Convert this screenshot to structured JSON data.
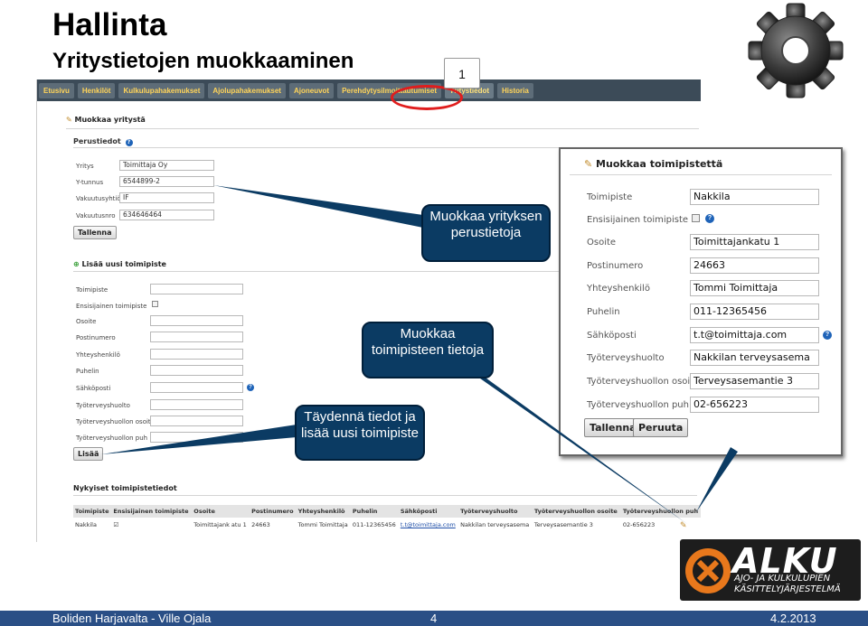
{
  "slide": {
    "title": "Hallinta",
    "subtitle": "Yritystietojen muokkaaminen",
    "marker_number": "1",
    "footer_left": "Boliden Harjavalta - Ville Ojala",
    "footer_center": "4",
    "footer_right": "4.2.2013"
  },
  "tabs": [
    "Etusivu",
    "Henkilöt",
    "Kulkulupahakemukset",
    "Ajolupahakemukset",
    "Ajoneuvot",
    "Perehdytysilmoittautumiset",
    "Yritystiedot",
    "Historia"
  ],
  "company_form": {
    "heading": "Muokkaa yritystä",
    "section": "Perustiedot",
    "fields": [
      {
        "label": "Yritys",
        "value": "Toimittaja Oy"
      },
      {
        "label": "Y-tunnus",
        "value": "6544899-2"
      },
      {
        "label": "Vakuutusyhtiö",
        "value": "IF"
      },
      {
        "label": "Vakuutusnro",
        "value": "634646464"
      }
    ],
    "save_label": "Tallenna"
  },
  "add_site_form": {
    "heading": "Lisää uusi toimipiste",
    "labels": [
      "Toimipiste",
      "Ensisijainen toimipiste",
      "Osoite",
      "Postinumero",
      "Yhteyshenkilö",
      "Puhelin",
      "Sähköposti",
      "Työterveyshuolto",
      "Työterveyshuollon osoite",
      "Työterveyshuollon puh"
    ],
    "add_label": "Lisää"
  },
  "sites_table": {
    "heading": "Nykyiset toimipistetiedot",
    "columns": [
      "Toimipiste",
      "Ensisijainen toimipiste",
      "Osoite",
      "Postinumero",
      "Yhteyshenkilö",
      "Puhelin",
      "Sähköposti",
      "Työterveyshuolto",
      "Työterveyshuollon osoite",
      "Työterveyshuollon puh"
    ],
    "rows": [
      [
        "Nakkila",
        "☑",
        "Toimittajank atu 1",
        "24663",
        "Tommi Toimittaja",
        "011-12365456",
        "t.t@toimittaja.com",
        "Nakkilan terveysasema",
        "Terveysasemantie 3",
        "02-656223"
      ]
    ]
  },
  "edit_site_popup": {
    "heading": "Muokkaa toimipistettä",
    "fields": [
      {
        "label": "Toimipiste",
        "value": "Nakkila"
      },
      {
        "label": "Ensisijainen toimipiste",
        "value": ""
      },
      {
        "label": "Osoite",
        "value": "Toimittajankatu 1"
      },
      {
        "label": "Postinumero",
        "value": "24663"
      },
      {
        "label": "Yhteyshenkilö",
        "value": "Tommi Toimittaja"
      },
      {
        "label": "Puhelin",
        "value": "011-12365456"
      },
      {
        "label": "Sähköposti",
        "value": "t.t@toimittaja.com"
      },
      {
        "label": "Työterveyshuolto",
        "value": "Nakkilan terveysasema"
      },
      {
        "label": "Työterveyshuollon osoite",
        "value": "Terveysasemantie 3"
      },
      {
        "label": "Työterveyshuollon puh",
        "value": "02-656223"
      }
    ],
    "save_label": "Tallenna",
    "cancel_label": "Peruuta"
  },
  "callouts": {
    "company": "Muokkaa yrityksen perustietoja",
    "site": "Muokkaa toimipisteen tietoja",
    "add": "Täydennä tiedot ja lisää uusi toimipiste"
  },
  "logo": {
    "brand": "ALKU",
    "line1": "AJO- JA KULKULUPIEN",
    "line2": "KÄSITTELYJÄRJESTELMÄ"
  },
  "colors": {
    "callout": "#0b3b63",
    "tabbar": "#3c4b58",
    "tab_text": "#ffd45a",
    "footer": "#2a4f86",
    "highlight_ring": "#e01d1d"
  }
}
